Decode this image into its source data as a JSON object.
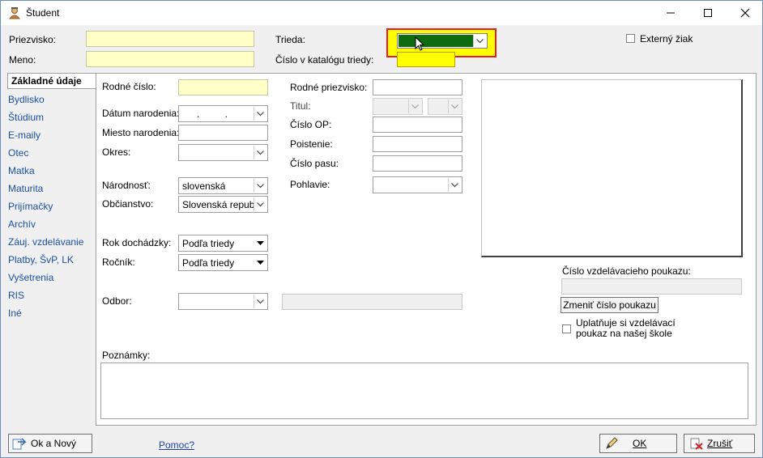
{
  "window": {
    "title": "Študent"
  },
  "header": {
    "priezvisko_label": "Priezvisko:",
    "meno_label": "Meno:",
    "trieda_label": "Trieda:",
    "cislo_katalog_label": "Číslo v katalógu triedy:",
    "externy_label": "Externý žiak"
  },
  "nav": {
    "items": [
      {
        "label": "Základné údaje"
      },
      {
        "label": "Bydlisko"
      },
      {
        "label": "Štúdium"
      },
      {
        "label": "E-maily"
      },
      {
        "label": "Otec"
      },
      {
        "label": "Matka"
      },
      {
        "label": "Maturita"
      },
      {
        "label": "Prijímačky"
      },
      {
        "label": "Archív"
      },
      {
        "label": "Záuj. vzdelávanie"
      },
      {
        "label": "Platby, ŠvP, LK"
      },
      {
        "label": "Vyšetrenia"
      },
      {
        "label": "RIS"
      },
      {
        "label": "Iné"
      }
    ]
  },
  "form": {
    "rodne_cislo_label": "Rodné číslo:",
    "datum_label": "Dátum narodenia:",
    "datum_value": ". .",
    "miesto_label": "Miesto narodenia:",
    "okres_label": "Okres:",
    "narodnost_label": "Národnosť:",
    "narodnost_value": "slovenská",
    "obcianstvo_label": "Občianstvo:",
    "obcianstvo_value": "Slovenská republ",
    "rok_label": "Rok dochádzky:",
    "rok_value": "Podľa triedy",
    "rocnik_label": "Ročník:",
    "rocnik_value": "Podľa triedy",
    "odbor_label": "Odbor:",
    "rodne_priezvisko_label": "Rodné priezvisko:",
    "titul_label": "Titul:",
    "cislo_op_label": "Číslo OP:",
    "poistenie_label": "Poistenie:",
    "cislo_pasu_label": "Číslo pasu:",
    "pohlavie_label": "Pohlavie:",
    "poukaz_label": "Číslo vzdelávacieho poukazu:",
    "zmenit_button": "Zmeniť číslo poukazu",
    "uplatnuje_line1": "Uplatňuje si vzdelávací",
    "uplatnuje_line2": "poukaz na našej škole",
    "poznamky_label": "Poznámky:"
  },
  "footer": {
    "ok_novy": "Ok a Nový",
    "pomoc": "Pomoc?",
    "ok": "OK",
    "zrusit": "Zrušiť"
  },
  "colors": {
    "trieda_highlight": "#ffff00",
    "trieda_border": "#e02020",
    "trieda_fill": "#0f6b0f"
  }
}
